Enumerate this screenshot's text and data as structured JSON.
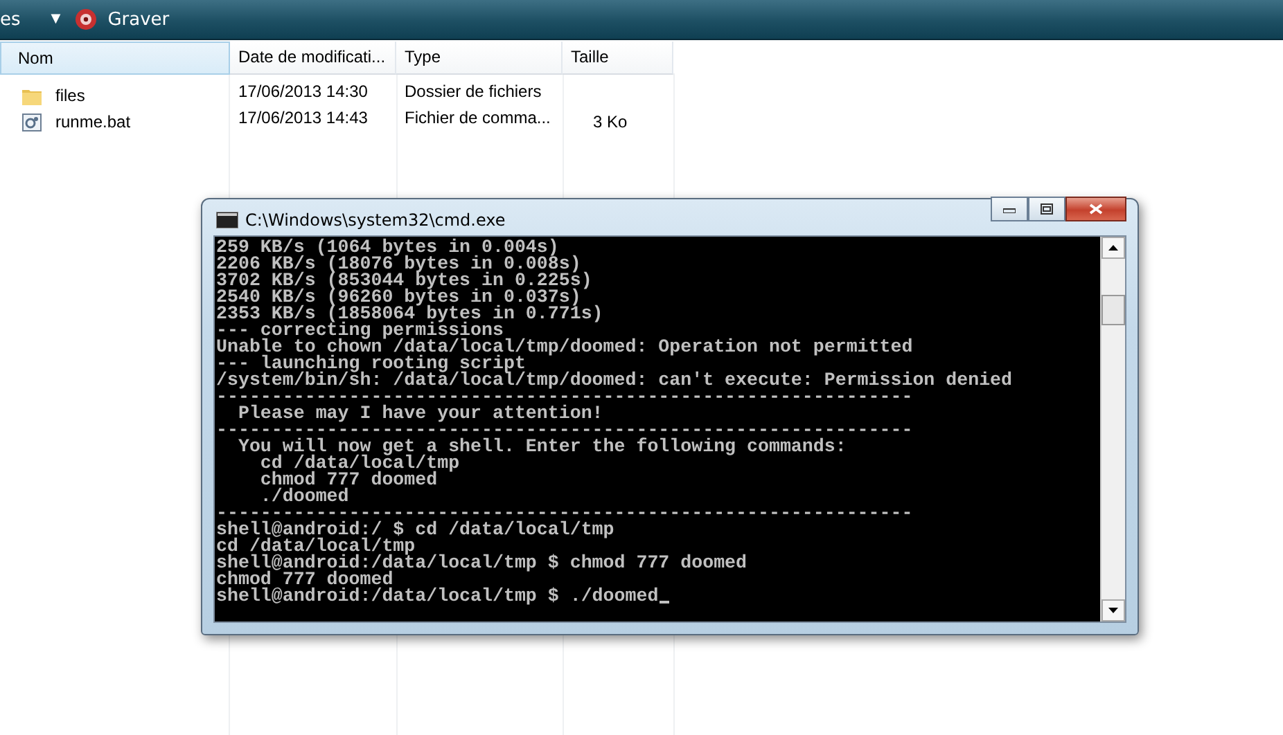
{
  "toolbar": {
    "items": [
      {
        "label": "es",
        "caret": "▼"
      },
      {
        "label": "Graver"
      }
    ]
  },
  "file_list": {
    "columns": [
      "Nom",
      "Date de modificati...",
      "Type",
      "Taille"
    ],
    "rows": [
      {
        "kind": "folder",
        "name": "files",
        "date": "17/06/2013 14:30",
        "type": "Dossier de fichiers",
        "size": ""
      },
      {
        "kind": "batch",
        "name": "runme.bat",
        "date": "17/06/2013 14:43",
        "type": "Fichier de comma...",
        "size": "3 Ko"
      }
    ]
  },
  "console_window": {
    "title": "C:\\Windows\\system32\\cmd.exe",
    "lines": [
      "259 KB/s (1064 bytes in 0.004s)",
      "2206 KB/s (18076 bytes in 0.008s)",
      "3702 KB/s (853044 bytes in 0.225s)",
      "2540 KB/s (96260 bytes in 0.037s)",
      "2353 KB/s (1858064 bytes in 0.771s)",
      "--- correcting permissions",
      "Unable to chown /data/local/tmp/doomed: Operation not permitted",
      "--- launching rooting script",
      "/system/bin/sh: /data/local/tmp/doomed: can't execute: Permission denied",
      "---------------------------------------------------------------",
      "  Please may I have your attention!",
      "---------------------------------------------------------------",
      "  You will now get a shell. Enter the following commands:",
      "    cd /data/local/tmp",
      "    chmod 777 doomed",
      "    ./doomed",
      "---------------------------------------------------------------",
      "shell@android:/ $ cd /data/local/tmp",
      "cd /data/local/tmp",
      "shell@android:/data/local/tmp $ chmod 777 doomed",
      "chmod 777 doomed",
      "shell@android:/data/local/tmp $ ./doomed"
    ]
  }
}
